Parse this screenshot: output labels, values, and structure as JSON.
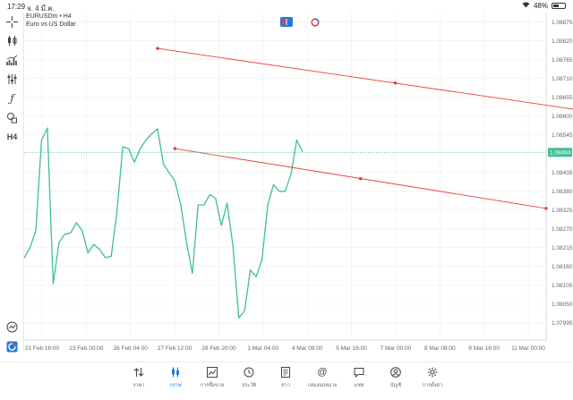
{
  "status_bar": {
    "time": "17:29",
    "date": "จ. 4 มี.ค.",
    "battery": "48%",
    "battery_level": 0.48
  },
  "symbol": {
    "title": "EURUSDm • H4",
    "description": "Euro vs US Dollar"
  },
  "left_toolbar": {
    "timeframe": "H4"
  },
  "colors": {
    "price_line": "#3fbf8f",
    "trendline": "#e8413d",
    "accent": "#1e7ae0",
    "grid": "#ededed"
  },
  "chart_data": {
    "type": "line",
    "title": "",
    "xlabel": "",
    "ylabel": "",
    "ylim": [
      1.07945,
      1.08903
    ],
    "x_tick_labels": [
      "21 Feb 16:00",
      "23 Feb 00:00",
      "26 Feb 04:00",
      "27 Feb 12:00",
      "28 Feb 20:00",
      "1 Mar 04:00",
      "4 Mar 08:00",
      "5 Mar 16:00",
      "7 Mar 00:00",
      "8 Mar 08:00",
      "9 Mar 16:00",
      "11 Mar 00:00"
    ],
    "y_ticks": [
      1.07995,
      1.0805,
      1.08105,
      1.0816,
      1.08215,
      1.0827,
      1.08325,
      1.0838,
      1.08435,
      1.08545,
      1.086,
      1.08655,
      1.0871,
      1.08765,
      1.0882,
      1.08875
    ],
    "y_tick_labels": [
      "1.07995",
      "1.08050",
      "1.08105",
      "1.08160",
      "1.08215",
      "1.08270",
      "1.08325",
      "1.08380",
      "1.08435",
      "1.08545",
      "1.08600",
      "1.08655",
      "1.08710",
      "1.08765",
      "1.08820",
      "1.08875"
    ],
    "current_price": 1.08494,
    "current_price_label": "1.08494",
    "x_index_range": [
      0,
      90
    ],
    "series": [
      {
        "values": [
          1.08185,
          1.08215,
          1.08265,
          1.0853,
          1.08565,
          1.0811,
          1.0823,
          1.08255,
          1.08258,
          1.08288,
          1.08265,
          1.082,
          1.08225,
          1.0821,
          1.08186,
          1.0819,
          1.0832,
          1.0851,
          1.08505,
          1.08465,
          1.08505,
          1.0853,
          1.08548,
          1.08563,
          1.0846,
          1.08435,
          1.0841,
          1.0834,
          1.0823,
          1.0814,
          1.0834,
          1.0834,
          1.0837,
          1.0836,
          1.0828,
          1.08345,
          1.0822,
          1.0801,
          1.0803,
          1.0815,
          1.0813,
          1.0818,
          1.0834,
          1.084,
          1.0838,
          1.0838,
          1.0843,
          1.0853,
          1.08495
        ]
      }
    ],
    "trendlines": [
      {
        "points": [
          {
            "x": 23,
            "y": 1.08798
          },
          {
            "x": 64,
            "y": 1.08697
          },
          {
            "x": 105,
            "y": 1.08595
          }
        ]
      },
      {
        "points": [
          {
            "x": 26,
            "y": 1.08505
          },
          {
            "x": 58,
            "y": 1.08417
          },
          {
            "x": 90,
            "y": 1.0833
          }
        ]
      }
    ]
  },
  "bottom_nav": [
    {
      "label": "ราคา",
      "icon": "quotes-arrows-icon",
      "active": false
    },
    {
      "label": "กราฟ",
      "icon": "candlestick-chart-icon",
      "active": true
    },
    {
      "label": "การซื้อขาย",
      "icon": "trade-chart-icon",
      "active": false
    },
    {
      "label": "ประวัติ",
      "icon": "history-clock-icon",
      "active": false
    },
    {
      "label": "ข่าว",
      "icon": "news-book-icon",
      "active": false
    },
    {
      "label": "กล่องจดหมาย",
      "icon": "mailbox-at-icon",
      "active": false
    },
    {
      "label": "แชท",
      "icon": "chat-bubble-icon",
      "active": false
    },
    {
      "label": "บัญชี",
      "icon": "account-avatar-icon",
      "active": false
    },
    {
      "label": "การตั้งค่า",
      "icon": "settings-gear-icon",
      "active": false
    }
  ]
}
